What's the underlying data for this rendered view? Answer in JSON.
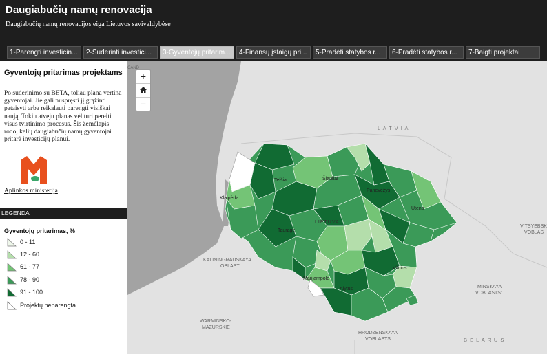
{
  "header": {
    "title": "Daugiabučių namų renovacija",
    "subtitle": "Daugiabučių namų renovacijos eiga Lietuvos savivaldybėse"
  },
  "tabs": [
    {
      "label": "1-Parengti investicin..."
    },
    {
      "label": "2-Suderinti investici..."
    },
    {
      "label": "3-Gyventojų pritarim..."
    },
    {
      "label": "4-Finansų įstaigų pri..."
    },
    {
      "label": "5-Pradėti statybos r..."
    },
    {
      "label": "6-Pradėti statybos r..."
    },
    {
      "label": "7-Baigti projektai"
    }
  ],
  "active_tab": 2,
  "sidebar": {
    "title": "Gyventojų pritarimas projektams",
    "text": "Po suderinimo su BETA, toliau planą vertina gyventojai. Jie gali nuspręsti jį grąžinti pataisyti arba reikalauti parengti visiškai naują. Tokiu atveju planas vėl turi pereiti visus tvirtinimo procesus. Šis žemėlapis rodo, kelių daugiabučių namų gyventojai pritarė investicijų planui.",
    "ministry_link": "Aplinkos ministerija"
  },
  "legend": {
    "header": "LEGENDA",
    "title": "Gyventojų pritarimas, %",
    "items": [
      {
        "label": "0 - 11",
        "color": "#eff7eb"
      },
      {
        "label": "12 - 60",
        "color": "#b4deab"
      },
      {
        "label": "61 - 77",
        "color": "#74c476"
      },
      {
        "label": "78 - 90",
        "color": "#3b9a58"
      },
      {
        "label": "91 - 100",
        "color": "#116b33"
      },
      {
        "label": "Projektų neparengta",
        "color": "#ffffff"
      }
    ]
  },
  "map": {
    "zoom_in": "+",
    "zoom_out": "−",
    "home_icon": "home-icon",
    "labels": {
      "latvia": "L A T V I A",
      "kaliningrad": "KALININGRADSKAYA\nOBLAST'",
      "warminsko": "WARMINSKO-\nMAZURSKIE",
      "hrodzenskaya": "HRODZENSKAYA\nVOBLASTS'",
      "belarus": "B E L A R U S",
      "minskaya": "MINSKAYA\nVOBLASTS'",
      "vitsyebsk": "VITSYEBSK\nVOBLAS",
      "cand": "CAND"
    },
    "cities": {
      "klaipeda": "Klaipėda",
      "siauliai": "Šiauliai",
      "panevezys": "Panevėžys",
      "telsiai": "Telšiai",
      "taurage": "Tauragė",
      "utena": "Utena",
      "marijampole": "Marijampolė",
      "alytus": "Alytus",
      "vilnius": "Vilnius",
      "lietuva": "LIETUVA"
    }
  }
}
